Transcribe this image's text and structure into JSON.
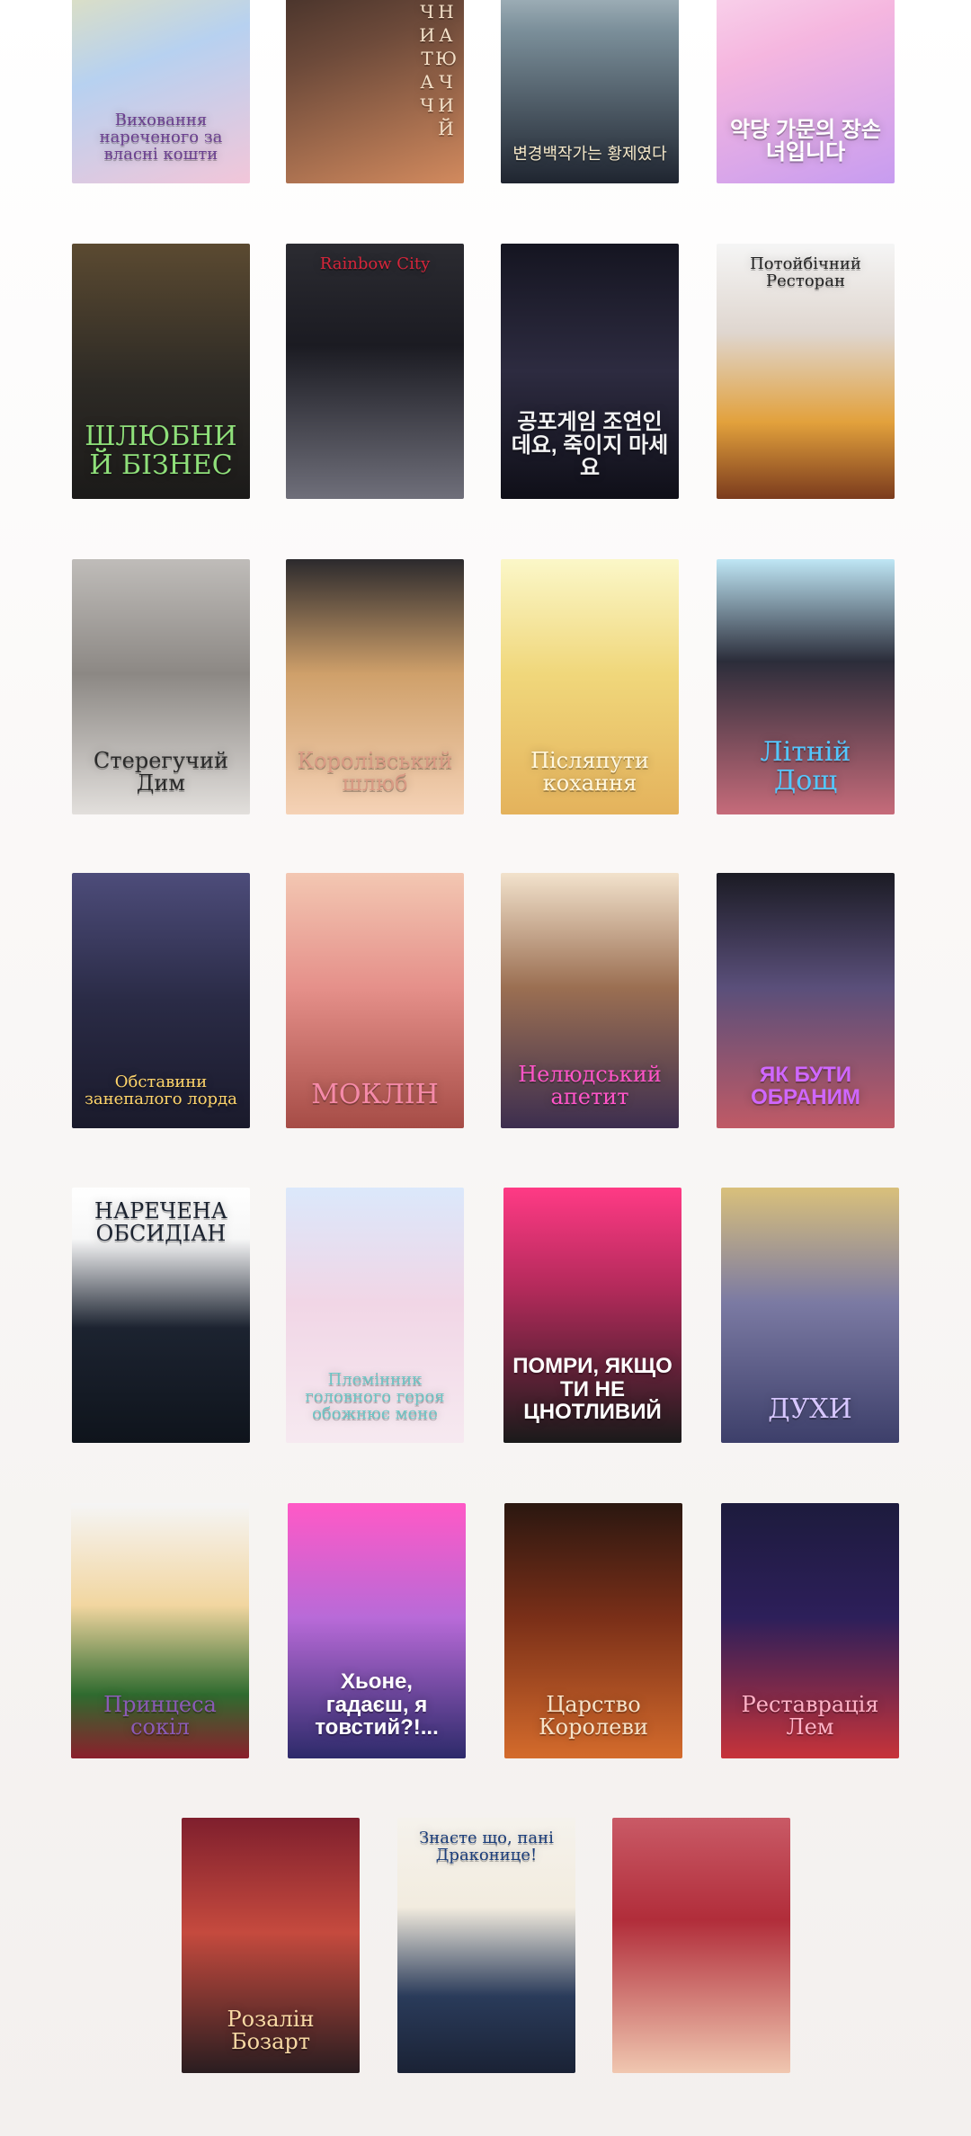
{
  "grid": {
    "covers": [
      {
        "title": "Виховання нареченого за власні кошти",
        "bg": "linear-gradient(160deg,#f6e9a6,#b7d1f0 50%,#f2c6d9)",
        "color": "#6a3f8f",
        "style": "t-serif t-size-s t-bottom"
      },
      {
        "title": "ЗНАЮЧИЙ ЧИТАЧ",
        "bg": "linear-gradient(160deg,#2a211f,#6d4a3a 45%,#d28a5e)",
        "color": "#f3e0c8",
        "style": "t-vertical t-serif"
      },
      {
        "title": "변경백작가는 황제였다",
        "bg": "linear-gradient(180deg,#e7f0f3,#7b8f9a 40%,#1f2530)",
        "color": "#f4e7c7",
        "style": "t-serif t-size-s t-bottom"
      },
      {
        "title": "악당 가문의 장손녀입니다",
        "bg": "linear-gradient(160deg,#fbe8f4,#f5b6df 45%,#c79cf0)",
        "color": "#ffffff",
        "style": "t-sans t-size-m t-bottom"
      },
      {
        "title": "ШЛЮБНИЙ БІЗНЕС",
        "bg": "linear-gradient(180deg,#5b4a31,#2d2a25 55%,#1b1a19)",
        "color": "#8fe07a",
        "style": "t-serif t-size-l t-bottom"
      },
      {
        "title": "Rainbow City",
        "bg": "linear-gradient(180deg,#2b2b31,#1b1b22 40%,#6f6f7a)",
        "color": "#d6253a",
        "style": "t-serif t-size-s t-top"
      },
      {
        "title": "공포게임 조연인데요, 죽이지 마세요",
        "bg": "linear-gradient(180deg,#151521,#2d2b40 50%,#0f0f18)",
        "color": "#f3f3f3",
        "style": "t-sans t-size-m t-bottom"
      },
      {
        "title": "Потойбічний Ресторан",
        "bg": "linear-gradient(180deg,#f5f5f5,#dfd6cf 35%,#e2a13c 70%,#7b3b1d)",
        "color": "#222222",
        "style": "t-serif t-size-s t-top"
      },
      {
        "title": "Стерегучий Дим",
        "bg": "linear-gradient(180deg,#bfbcb9,#8c8884 45%,#e2dfdc)",
        "color": "#2a2a2a",
        "style": "t-serif t-size-m t-bottom"
      },
      {
        "title": "Королівський шлюб",
        "bg": "linear-gradient(180deg,#2c2a2d,#cfa06a 45%,#f5d2b6)",
        "color": "#d99a84",
        "style": "t-serif t-size-m t-bottom"
      },
      {
        "title": "Післяпути кохання",
        "bg": "linear-gradient(180deg,#fbf7c8,#f0d77b 45%,#e4b25c)",
        "color": "#fff7df",
        "style": "t-serif t-size-m t-bottom"
      },
      {
        "title": "Літній Дощ",
        "bg": "linear-gradient(180deg,#bfe6f5,#2b2d3a 40%,#c66b7a)",
        "color": "#53c7ff",
        "style": "t-serif t-size-l t-bottom"
      },
      {
        "title": "Обставини занепалого лорда",
        "bg": "linear-gradient(180deg,#4d4c7a,#2a2b46 50%,#1a1a2b)",
        "color": "#ffd56b",
        "style": "t-serif t-size-s t-bottom"
      },
      {
        "title": "МОКЛІН",
        "bg": "linear-gradient(180deg,#f3c7b2,#e5908a 45%,#a64c46)",
        "color": "#f58aa9",
        "style": "t-serif t-size-l t-bottom"
      },
      {
        "title": "Нелюдський апетит",
        "bg": "linear-gradient(180deg,#f2e2cc,#9b6f52 45%,#3d2e4f)",
        "color": "#ff54c8",
        "style": "t-serif t-size-m t-bottom"
      },
      {
        "title": "ЯК БУТИ ОБРАНИМ",
        "bg": "linear-gradient(180deg,#1b1b24,#5a4f7a 45%,#c05a66)",
        "color": "#cf67ff",
        "style": "t-sans t-size-m t-bottom"
      },
      {
        "title": "НАРЕЧЕНА ОБСИДІАН",
        "bg": "linear-gradient(180deg,#ffffff,#f7f7f7 20%,#1c2330 55%,#0f141c)",
        "color": "#1c2330",
        "style": "t-serif t-size-m t-top"
      },
      {
        "title": "Племінник головного героя обожнює мене",
        "bg": "linear-gradient(180deg,#dbe8fb,#f1d6e6 45%,#f6e9f0)",
        "color": "#6cc4c4",
        "style": "t-serif t-size-s t-bottom"
      },
      {
        "title": "ПОМРИ, ЯКЩО ТИ НЕ ЦНОТЛИВИЙ",
        "bg": "linear-gradient(180deg,#ff3a85,#b22a5a 40%,#1a1a1a)",
        "color": "#ffffff",
        "style": "t-sans t-size-m t-bottom"
      },
      {
        "title": "ДУХИ",
        "bg": "linear-gradient(180deg,#d9c07b,#7b7aa3 45%,#3d3f6a)",
        "color": "#d6c6ff",
        "style": "t-serif t-size-l t-bottom"
      },
      {
        "title": "Принцеса сокіл",
        "bg": "linear-gradient(180deg,#f5f5f5,#f2d6a0 40%,#2f6b2f 75%,#8b1f2c)",
        "color": "#8a5ab5",
        "style": "t-serif t-size-m t-bottom"
      },
      {
        "title": "Хьоне, гадаєш, я товстий?!...",
        "bg": "linear-gradient(180deg,#ff59c6,#b86ad8 45%,#2d2a6a)",
        "color": "#ffffff",
        "style": "t-sans t-size-m t-bottom"
      },
      {
        "title": "Царство Королеви",
        "bg": "linear-gradient(180deg,#2b1710,#7a2f18 45%,#d46b2c)",
        "color": "#f5e2c8",
        "style": "t-serif t-size-m t-bottom"
      },
      {
        "title": "Реставрація Лем",
        "bg": "linear-gradient(180deg,#1d1b3d,#2d1f5a 45%,#c7333a)",
        "color": "#ffb3c7",
        "style": "t-serif t-size-m t-bottom"
      },
      {
        "title": "Розалін Бозарт",
        "bg": "linear-gradient(180deg,#7f1f2d,#c54a3e 45%,#2a1d20)",
        "color": "#f7d9a4",
        "style": "t-serif t-size-m t-bottom"
      },
      {
        "title": "Знаєте що, пані Драконице!",
        "bg": "linear-gradient(180deg,#f5f2ec,#f2ecdf 35%,#2a3b5a 70%,#1a2235)",
        "color": "#1b3d7a",
        "style": "t-serif t-size-s t-top"
      },
      {
        "title": "",
        "bg": "linear-gradient(180deg,#c95a66,#b12d3a 40%,#f0c7b0)",
        "color": "#ffffff",
        "style": "t-serif t-size-m t-bottom"
      }
    ]
  }
}
